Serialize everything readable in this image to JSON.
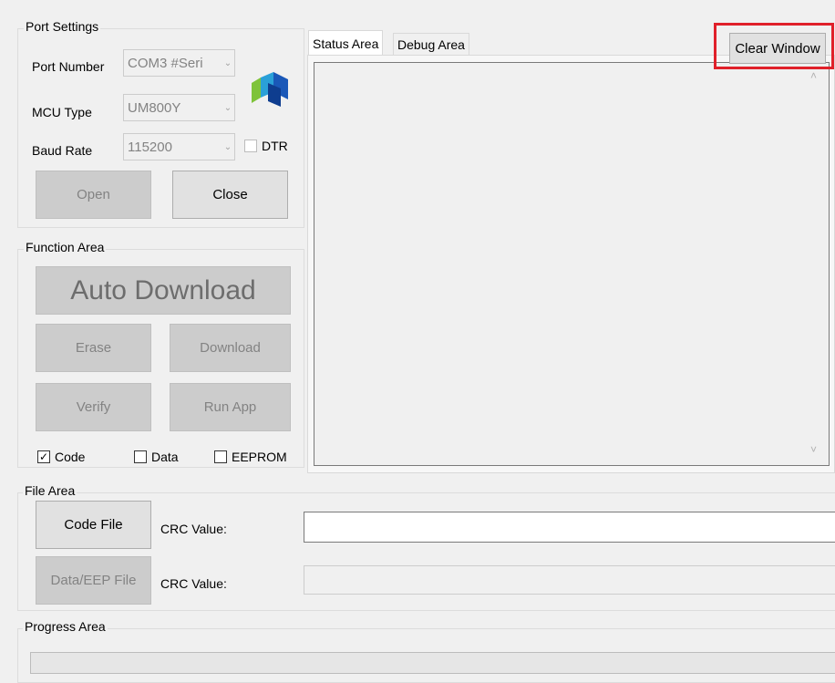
{
  "port_settings": {
    "title": "Port Settings",
    "port_number_label": "Port Number",
    "port_number_value": "COM3 #Seri",
    "mcu_type_label": "MCU Type",
    "mcu_type_value": "UM800Y",
    "baud_rate_label": "Baud Rate",
    "baud_rate_value": "115200",
    "dtr_label": "DTR",
    "open_label": "Open",
    "close_label": "Close"
  },
  "function_area": {
    "title": "Function Area",
    "auto_download_label": "Auto Download",
    "erase_label": "Erase",
    "download_label": "Download",
    "verify_label": "Verify",
    "run_app_label": "Run App",
    "code_label": "Code",
    "data_label": "Data",
    "eeprom_label": "EEPROM",
    "code_checked": true,
    "data_checked": false,
    "eeprom_checked": false
  },
  "tabs": {
    "status_area": "Status Area",
    "debug_area": "Debug Area",
    "clear_window": "Clear Window"
  },
  "file_area": {
    "title": "File Area",
    "code_file_label": "Code File",
    "code_crc_label": "CRC Value:",
    "data_eep_label": "Data/EEP File",
    "data_crc_label": "CRC Value:"
  },
  "progress_area": {
    "title": "Progress Area"
  },
  "colors": {
    "highlight": "#e0202a",
    "window_bg": "#f0f0f0"
  }
}
